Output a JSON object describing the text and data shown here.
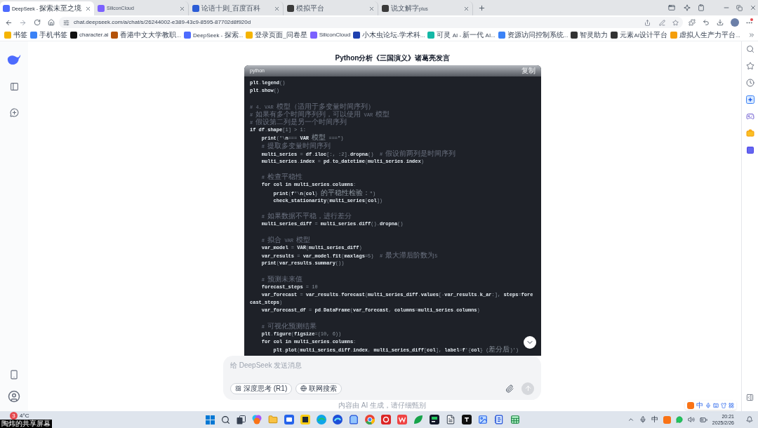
{
  "browser": {
    "tabs": [
      {
        "title": "DeepSeek - 探索未至之境",
        "selected": true,
        "color": "#4d6bfe"
      },
      {
        "title": "SiliconCloud",
        "selected": false,
        "color": "#7b61ff"
      },
      {
        "title": "论语十则_百度百科",
        "selected": false,
        "color": "#2b5cd6"
      },
      {
        "title": "模拟平台",
        "selected": false,
        "color": "#3a3a3a"
      },
      {
        "title": "说文解字plus",
        "selected": false,
        "color": "#3a3a3a"
      }
    ]
  },
  "address_bar": {
    "url": "chat.deepseek.com/a/chat/s/26244002-e389-43c9-8595-87702d8f920d"
  },
  "bookmarks": [
    {
      "label": "书签",
      "color": "#f5b400"
    },
    {
      "label": "手机书签",
      "color": "#3b82f6"
    },
    {
      "label": "character.ai",
      "color": "#111111"
    },
    {
      "label": "香港中文大学教职...",
      "color": "#b45309"
    },
    {
      "label": "DeepSeek - 探索...",
      "color": "#4d6bfe"
    },
    {
      "label": "登录页面_问卷星",
      "color": "#f5b400"
    },
    {
      "label": "SiliconCloud",
      "color": "#7b61ff"
    },
    {
      "label": "小木虫论坛-学术科...",
      "color": "#1e40af"
    },
    {
      "label": "可灵 AI - 新一代 AI...",
      "color": "#14b8a6"
    },
    {
      "label": "资源访问控制系统...",
      "color": "#3b82f6"
    },
    {
      "label": "智灵助力",
      "color": "#333333"
    },
    {
      "label": "元素AI设计平台",
      "color": "#333333"
    },
    {
      "label": "虚拟人生产力平台...",
      "color": "#f59e0b"
    }
  ],
  "chat": {
    "title": "Python分析《三国演义》诸葛亮发言",
    "code_block": {
      "language": "python",
      "copy_label": "复制",
      "blocks": [
        [
          "plt.legend()",
          "plt.show()"
        ],
        [
          "# 4. VAR 模型（适用于多变量时间序列）",
          "# 如果有多个时间序列列，可以使用 VAR 模型",
          "# 假设第二列是另一个时间序列",
          "if df.shape[1] > 1:",
          "    print(\"\\n=== VAR 模型 ===\")",
          "    # 提取多变量时间序列",
          "    multi_series = df.iloc[:, :2].dropna()  # 假设前两列是时间序列",
          "    multi_series.index = pd.to_datetime(multi_series.index)"
        ],
        [
          "    # 检查平稳性",
          "    for col in multi_series.columns:",
          "        print(f\"\\n{col} 的平稳性检验：\")",
          "        check_stationarity(multi_series[col])"
        ],
        [
          "    # 如果数据不平稳，进行差分",
          "    multi_series_diff = multi_series.diff().dropna()"
        ],
        [
          "    # 拟合 VAR 模型",
          "    var_model = VAR(multi_series_diff)",
          "    var_results = var_model.fit(maxlags=5)  # 最大滞后阶数为5",
          "    print(var_results.summary())"
        ],
        [
          "    # 预测未来值",
          "    forecast_steps = 10",
          "    var_forecast = var_results.forecast(multi_series_diff.values[-var_results.k_ar:], steps=fore",
          "cast_steps)",
          "    var_forecast_df = pd.DataFrame(var_forecast, columns=multi_series.columns)"
        ],
        [
          "    # 可视化预测结果",
          "    plt.figure(figsize=(10, 6))",
          "    for col in multi_series.columns:",
          "        plt.plot(multi_series_diff.index, multi_series_diff[col], label=f'{col} (差分后)')"
        ]
      ]
    }
  },
  "composer": {
    "placeholder": "给 DeepSeek 发送消息",
    "toggles": [
      {
        "label": "深度思考 (R1)",
        "selected": false
      },
      {
        "label": "联网搜索",
        "selected": false
      }
    ]
  },
  "disclaimer": "内容由 AI 生成，请仔细甄别",
  "ime_bar": {
    "mode": "中"
  },
  "taskbar": {
    "weather_badge": "3",
    "weather": "4°C",
    "ime": "中",
    "time": "20:21",
    "date": "2025/2/26"
  },
  "share_label": "陶炜的共享屏幕"
}
